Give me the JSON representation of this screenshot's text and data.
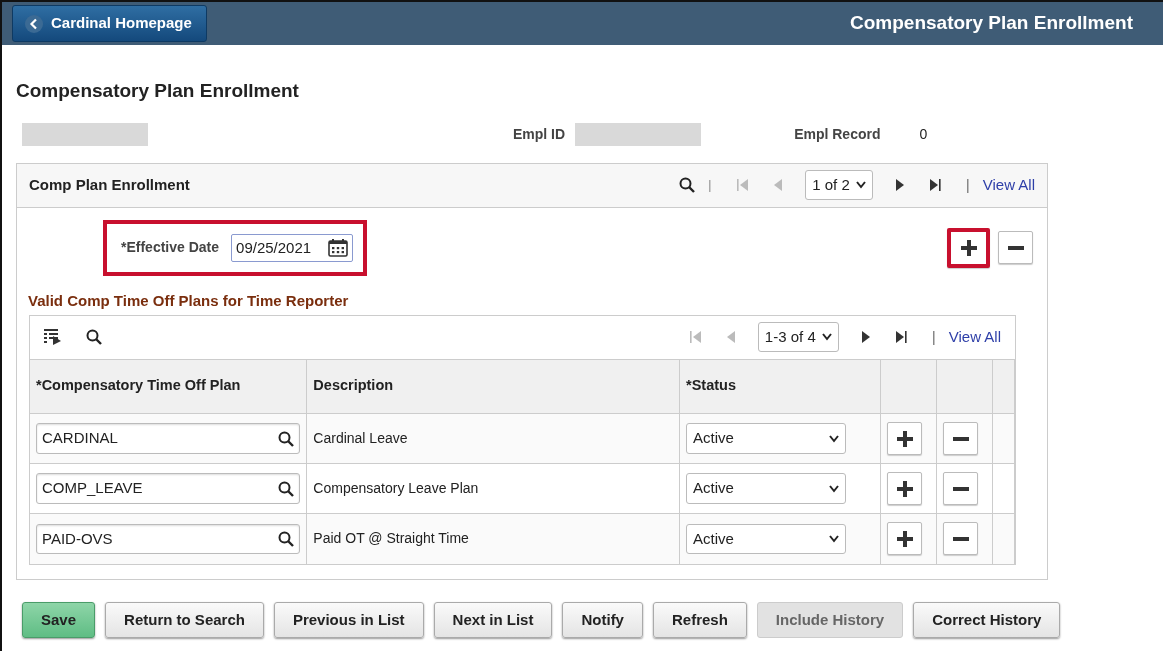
{
  "header": {
    "back_button": "Cardinal Homepage",
    "title": "Compensatory Plan Enrollment"
  },
  "page_title": "Compensatory Plan Enrollment",
  "employee": {
    "redacted": true,
    "empl_id_label": "Empl ID",
    "empl_record_label": "Empl Record",
    "empl_record": "0"
  },
  "enrollment": {
    "title": "Comp Plan Enrollment",
    "pager": {
      "range": "1 of 2",
      "can_go_back": false,
      "can_go_forward": true,
      "view_all": "View All"
    },
    "effective_date": {
      "label": "*Effective Date",
      "value": "09/25/2021",
      "highlighted": true
    },
    "row_actions": {
      "add_highlighted": true
    },
    "plans": {
      "title": "Valid Comp Time Off Plans for Time Reporter",
      "pager": {
        "range": "1-3 of 4",
        "can_go_back": false,
        "can_go_forward": true,
        "view_all": "View All"
      },
      "columns": [
        "*Compensatory Time Off Plan",
        "Description",
        "*Status"
      ],
      "rows": [
        {
          "plan": "CARDINAL",
          "description": "Cardinal Leave",
          "status": "Active"
        },
        {
          "plan": "COMP_LEAVE",
          "description": "Compensatory Leave Plan",
          "status": "Active"
        },
        {
          "plan": "PAID-OVS",
          "description": "Paid OT @ Straight Time",
          "status": "Active"
        }
      ]
    }
  },
  "buttons": [
    {
      "label": "Save",
      "kind": "primary",
      "disabled": false
    },
    {
      "label": "Return to Search",
      "kind": "default",
      "disabled": false
    },
    {
      "label": "Previous in List",
      "kind": "default",
      "disabled": false
    },
    {
      "label": "Next in List",
      "kind": "default",
      "disabled": false
    },
    {
      "label": "Notify",
      "kind": "default",
      "disabled": false
    },
    {
      "label": "Refresh",
      "kind": "default",
      "disabled": false
    },
    {
      "label": "Include History",
      "kind": "default",
      "disabled": true
    },
    {
      "label": "Correct History",
      "kind": "default",
      "disabled": false
    }
  ]
}
